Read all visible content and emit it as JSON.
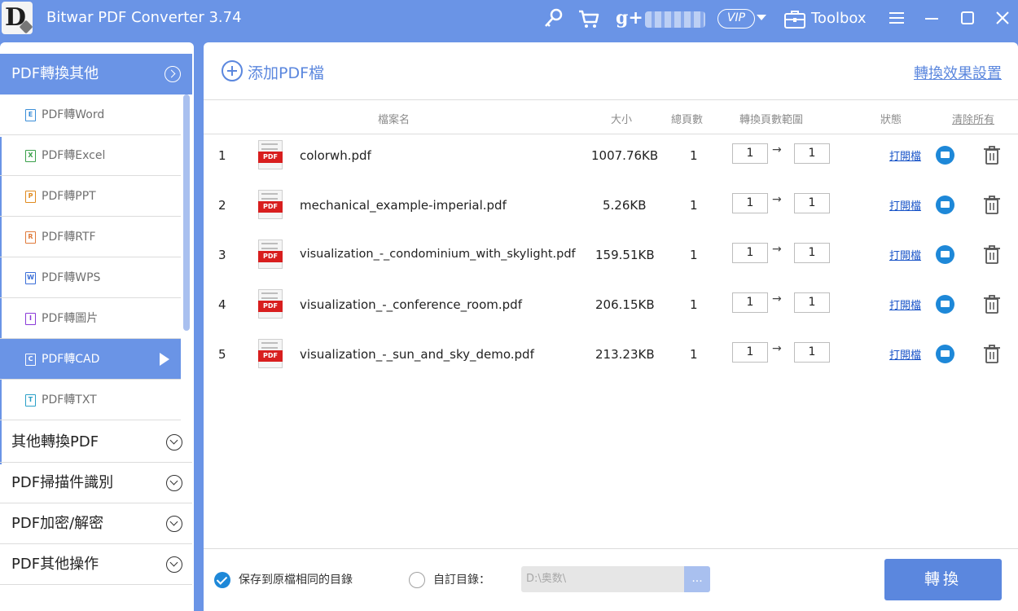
{
  "app": {
    "title": "Bitwar PDF Converter 3.74",
    "logo_letter": "D",
    "vip_label": "VIP",
    "toolbox_label": "Toolbox"
  },
  "icons": {
    "key": "key-icon",
    "cart": "cart-icon",
    "gplus": "g+",
    "menu": "menu-icon",
    "minimize": "minimize-icon",
    "maximize": "maximize-icon",
    "close": "close-icon"
  },
  "colors": {
    "accent": "#6a94e6",
    "link": "#5b87de",
    "pdf_red": "#d81e1e",
    "folder_blue": "#1e88d8"
  },
  "sidebar": {
    "header": "PDF轉換其他",
    "subitems": [
      {
        "label": "PDF轉Word",
        "tag": "E",
        "color": "#3a8ed8"
      },
      {
        "label": "PDF轉Excel",
        "tag": "X",
        "color": "#3aa04a"
      },
      {
        "label": "PDF轉PPT",
        "tag": "P",
        "color": "#e08a1e"
      },
      {
        "label": "PDF轉RTF",
        "tag": "R",
        "color": "#e07a3a"
      },
      {
        "label": "PDF轉WPS",
        "tag": "W",
        "color": "#3a6ed8"
      },
      {
        "label": "PDF轉圖片",
        "tag": "I",
        "color": "#8a3ad8"
      },
      {
        "label": "PDF轉CAD",
        "tag": "C",
        "color": "#ffffff"
      },
      {
        "label": "PDF轉TXT",
        "tag": "T",
        "color": "#2aa0c8"
      }
    ],
    "categories": [
      {
        "label": "其他轉換PDF"
      },
      {
        "label": "PDF掃描件識別"
      },
      {
        "label": "PDF加密/解密"
      },
      {
        "label": "PDF其他操作"
      }
    ]
  },
  "main": {
    "add_label": "添加PDF檔",
    "settings_link": "轉換效果設置",
    "columns": {
      "name": "檔案名",
      "size": "大小",
      "pages": "總頁數",
      "range": "轉換頁數範圍",
      "status": "狀態",
      "clear": "清除所有"
    },
    "open_label": "打開檔",
    "range_arrow": "→",
    "files": [
      {
        "index": "1",
        "name": "colorwh.pdf",
        "size": "1007.76KB",
        "pages": "1",
        "from": "1",
        "to": "1"
      },
      {
        "index": "2",
        "name": "mechanical_example-imperial.pdf",
        "size": "5.26KB",
        "pages": "1",
        "from": "1",
        "to": "1"
      },
      {
        "index": "3",
        "name": "visualization_-_condominium_with_skylight.pdf",
        "size": "159.51KB",
        "pages": "1",
        "from": "1",
        "to": "1"
      },
      {
        "index": "4",
        "name": "visualization_-_conference_room.pdf",
        "size": "206.15KB",
        "pages": "1",
        "from": "1",
        "to": "1"
      },
      {
        "index": "5",
        "name": "visualization_-_sun_and_sky_demo.pdf",
        "size": "213.23KB",
        "pages": "1",
        "from": "1",
        "to": "1"
      }
    ]
  },
  "bottom": {
    "save_same_dir": "保存到原檔相同的目錄",
    "custom_dir": "自訂目錄：",
    "dir_value": "D:\\奥数\\",
    "browse": "...",
    "convert": "轉換"
  }
}
